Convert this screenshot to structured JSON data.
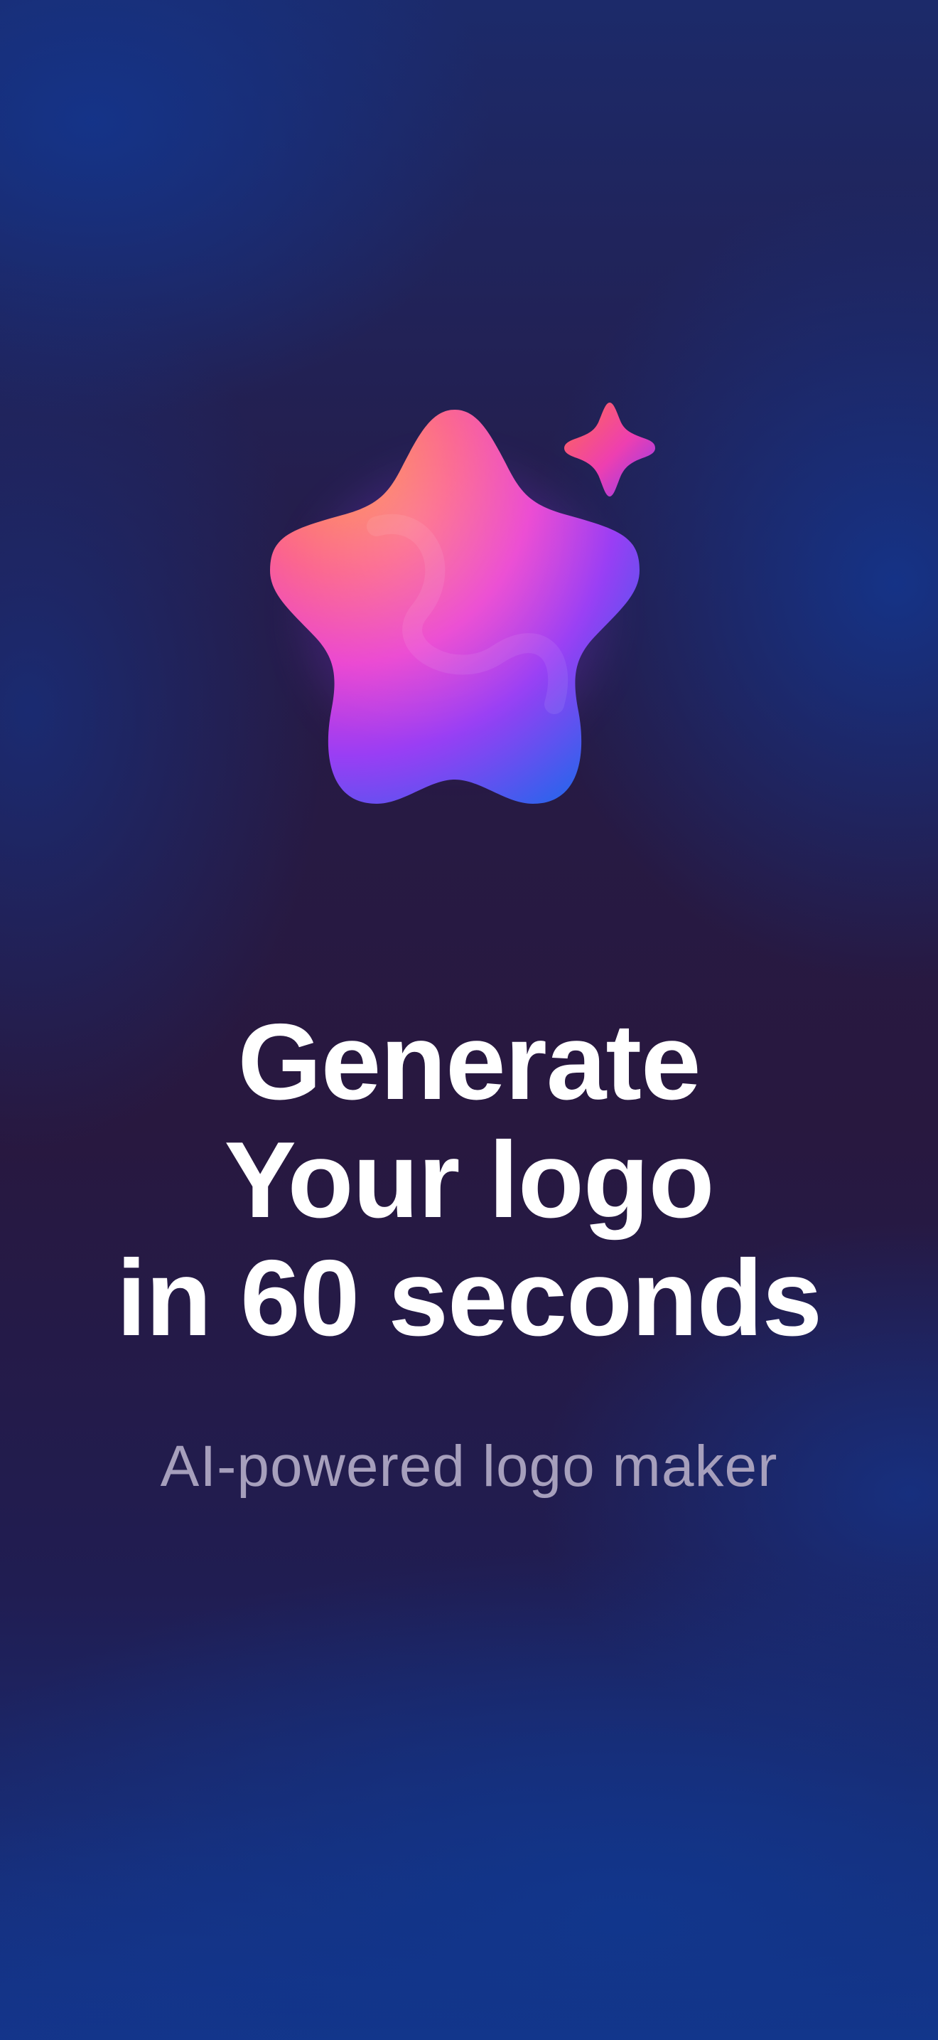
{
  "hero": {
    "icon": "star-sparkle-icon",
    "colors": {
      "orange": "#ff7a45",
      "pink": "#f23fb5",
      "purple": "#9b3cf5",
      "blue": "#3b57f0"
    }
  },
  "headline": {
    "line1": "Generate",
    "line2": "Your logo",
    "line3": "in 60 seconds"
  },
  "subtitle": "AI-powered logo maker",
  "theme": {
    "background_dark": "#271a40",
    "background_blue": "#14358a",
    "text_primary": "#ffffff",
    "text_secondary": "#a69fbc"
  }
}
